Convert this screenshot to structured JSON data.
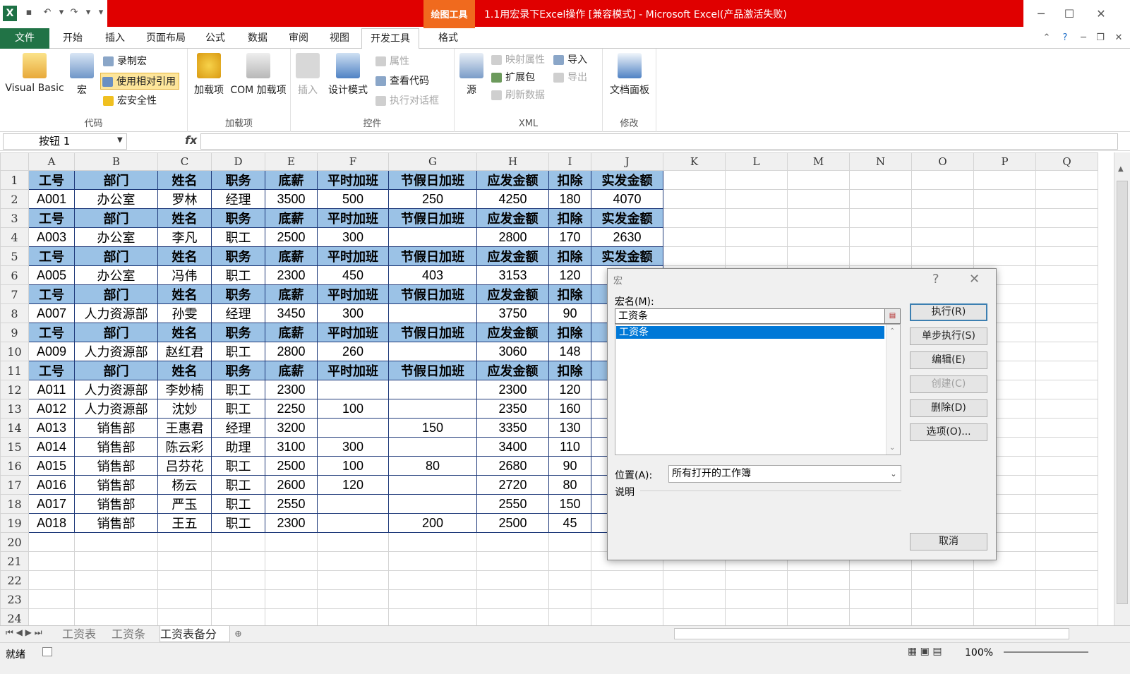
{
  "window": {
    "title": "1.1用宏录下Excel操作 [兼容模式] - Microsoft Excel(产品激活失败)",
    "context_tab": "绘图工具"
  },
  "tabs": [
    "文件",
    "开始",
    "插入",
    "页面布局",
    "公式",
    "数据",
    "审阅",
    "视图",
    "开发工具",
    "格式"
  ],
  "ribbon": {
    "code": {
      "label": "代码",
      "visual_basic": "Visual Basic",
      "macros": "宏",
      "record": "录制宏",
      "relative": "使用相对引用",
      "security": "宏安全性"
    },
    "addins": {
      "label": "加载项",
      "addins": "加载项",
      "com": "COM 加载项"
    },
    "controls": {
      "label": "控件",
      "insert": "插入",
      "design": "设计模式",
      "properties": "属性",
      "view_code": "查看代码",
      "run_dialog": "执行对话框"
    },
    "xml": {
      "label": "XML",
      "source": "源",
      "map_props": "映射属性",
      "expansion": "扩展包",
      "refresh": "刷新数据",
      "import": "导入",
      "export": "导出"
    },
    "modify": {
      "label": "修改",
      "doc_panel": "文档面板"
    }
  },
  "formula_bar": {
    "name_box": "按钮 1",
    "fx": "fx"
  },
  "columns": [
    "A",
    "B",
    "C",
    "D",
    "E",
    "F",
    "G",
    "H",
    "I",
    "J",
    "K",
    "L",
    "M",
    "N",
    "O",
    "P",
    "Q"
  ],
  "header_row": [
    "工号",
    "部门",
    "姓名",
    "职务",
    "底薪",
    "平时加班",
    "节假日加班",
    "应发金额",
    "扣除",
    "实发金额"
  ],
  "rows": [
    {
      "n": "1",
      "type": "header",
      "cells": [
        "工号",
        "部门",
        "姓名",
        "职务",
        "底薪",
        "平时加班",
        "节假日加班",
        "应发金额",
        "扣除",
        "实发金额"
      ]
    },
    {
      "n": "2",
      "type": "data",
      "cells": [
        "A001",
        "办公室",
        "罗林",
        "经理",
        "3500",
        "500",
        "250",
        "4250",
        "180",
        "4070"
      ]
    },
    {
      "n": "3",
      "type": "header",
      "cells": [
        "工号",
        "部门",
        "姓名",
        "职务",
        "底薪",
        "平时加班",
        "节假日加班",
        "应发金额",
        "扣除",
        "实发金额"
      ]
    },
    {
      "n": "4",
      "type": "data",
      "cells": [
        "A003",
        "办公室",
        "李凡",
        "职工",
        "2500",
        "300",
        "",
        "2800",
        "170",
        "2630"
      ]
    },
    {
      "n": "5",
      "type": "header",
      "cells": [
        "工号",
        "部门",
        "姓名",
        "职务",
        "底薪",
        "平时加班",
        "节假日加班",
        "应发金额",
        "扣除",
        "实发金额"
      ]
    },
    {
      "n": "6",
      "type": "data",
      "cells": [
        "A005",
        "办公室",
        "冯伟",
        "职工",
        "2300",
        "450",
        "403",
        "3153",
        "120",
        ""
      ]
    },
    {
      "n": "7",
      "type": "header",
      "cells": [
        "工号",
        "部门",
        "姓名",
        "职务",
        "底薪",
        "平时加班",
        "节假日加班",
        "应发金额",
        "扣除",
        ""
      ]
    },
    {
      "n": "8",
      "type": "data",
      "cells": [
        "A007",
        "人力资源部",
        "孙雯",
        "经理",
        "3450",
        "300",
        "",
        "3750",
        "90",
        ""
      ]
    },
    {
      "n": "9",
      "type": "header",
      "cells": [
        "工号",
        "部门",
        "姓名",
        "职务",
        "底薪",
        "平时加班",
        "节假日加班",
        "应发金额",
        "扣除",
        ""
      ]
    },
    {
      "n": "10",
      "type": "data",
      "cells": [
        "A009",
        "人力资源部",
        "赵红君",
        "职工",
        "2800",
        "260",
        "",
        "3060",
        "148",
        ""
      ]
    },
    {
      "n": "11",
      "type": "header",
      "cells": [
        "工号",
        "部门",
        "姓名",
        "职务",
        "底薪",
        "平时加班",
        "节假日加班",
        "应发金额",
        "扣除",
        ""
      ]
    },
    {
      "n": "12",
      "type": "data",
      "cells": [
        "A011",
        "人力资源部",
        "李妙楠",
        "职工",
        "2300",
        "",
        "",
        "2300",
        "120",
        ""
      ]
    },
    {
      "n": "13",
      "type": "data",
      "cells": [
        "A012",
        "人力资源部",
        "沈妙",
        "职工",
        "2250",
        "100",
        "",
        "2350",
        "160",
        ""
      ]
    },
    {
      "n": "14",
      "type": "data",
      "cells": [
        "A013",
        "销售部",
        "王惠君",
        "经理",
        "3200",
        "",
        "150",
        "3350",
        "130",
        ""
      ]
    },
    {
      "n": "15",
      "type": "data",
      "cells": [
        "A014",
        "销售部",
        "陈云彩",
        "助理",
        "3100",
        "300",
        "",
        "3400",
        "110",
        ""
      ]
    },
    {
      "n": "16",
      "type": "data",
      "cells": [
        "A015",
        "销售部",
        "吕芬花",
        "职工",
        "2500",
        "100",
        "80",
        "2680",
        "90",
        ""
      ]
    },
    {
      "n": "17",
      "type": "data",
      "cells": [
        "A016",
        "销售部",
        "杨云",
        "职工",
        "2600",
        "120",
        "",
        "2720",
        "80",
        ""
      ]
    },
    {
      "n": "18",
      "type": "data",
      "cells": [
        "A017",
        "销售部",
        "严玉",
        "职工",
        "2550",
        "",
        "",
        "2550",
        "150",
        ""
      ]
    },
    {
      "n": "19",
      "type": "data",
      "cells": [
        "A018",
        "销售部",
        "王五",
        "职工",
        "2300",
        "",
        "200",
        "2500",
        "45",
        ""
      ]
    },
    {
      "n": "20",
      "type": "empty"
    },
    {
      "n": "21",
      "type": "empty"
    },
    {
      "n": "22",
      "type": "empty"
    },
    {
      "n": "23",
      "type": "empty"
    },
    {
      "n": "24",
      "type": "empty"
    }
  ],
  "sheets": [
    "工资表",
    "工资条",
    "工资表备分"
  ],
  "status": {
    "ready": "就绪",
    "zoom": "100%"
  },
  "dialog": {
    "title": "宏",
    "help": "?",
    "close": "✕",
    "name_label": "宏名(M):",
    "name_value": "工资条",
    "list_items": [
      "工资条"
    ],
    "location_label": "位置(A):",
    "location_value": "所有打开的工作簿",
    "desc_label": "说明",
    "buttons": {
      "run": "执行(R)",
      "step": "单步执行(S)",
      "edit": "编辑(E)",
      "create": "创建(C)",
      "delete": "删除(D)",
      "options": "选项(O)...",
      "cancel": "取消"
    }
  },
  "colors": {
    "title_red": "#e00000",
    "file_green": "#217346",
    "header_fill": "#9bc2e6",
    "selection": "#0078d7"
  }
}
